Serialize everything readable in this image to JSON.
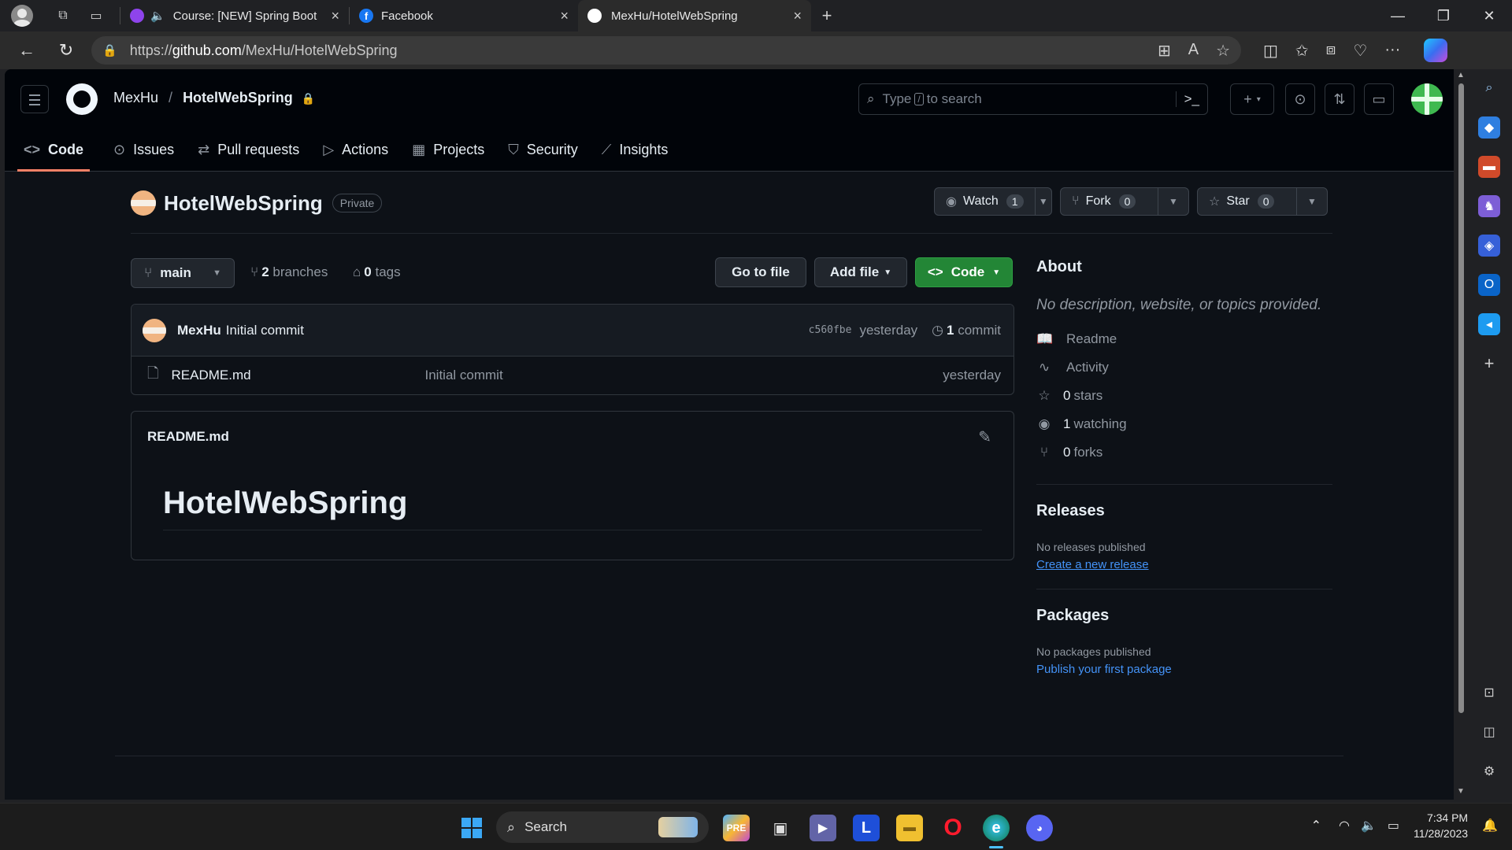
{
  "browser": {
    "tabs": [
      {
        "title": "Course: [NEW] Spring Boot",
        "icon": "udemy-icon"
      },
      {
        "title": "Facebook",
        "icon": "facebook-icon"
      },
      {
        "title": "MexHu/HotelWebSpring",
        "icon": "github-icon",
        "active": true
      }
    ],
    "url_prefix": "https://",
    "url_host": "github.com",
    "url_path": "/MexHu/HotelWebSpring"
  },
  "header": {
    "owner": "MexHu",
    "separator": "/",
    "repo": "HotelWebSpring",
    "search_prefix": "Type",
    "search_key": "/",
    "search_suffix": "to search"
  },
  "repo_nav": [
    {
      "label": "Code",
      "icon": "code-icon",
      "selected": true
    },
    {
      "label": "Issues",
      "icon": "issue-icon"
    },
    {
      "label": "Pull requests",
      "icon": "pull-request-icon"
    },
    {
      "label": "Actions",
      "icon": "play-icon"
    },
    {
      "label": "Projects",
      "icon": "table-icon"
    },
    {
      "label": "Security",
      "icon": "shield-icon"
    },
    {
      "label": "Insights",
      "icon": "graph-icon"
    }
  ],
  "repo": {
    "name": "HotelWebSpring",
    "visibility": "Private",
    "watch": {
      "label": "Watch",
      "count": "1"
    },
    "fork": {
      "label": "Fork",
      "count": "0"
    },
    "star": {
      "label": "Star",
      "count": "0"
    }
  },
  "branch": {
    "current": "main",
    "branches_count": "2",
    "branches_label": "branches",
    "tags_count": "0",
    "tags_label": "tags",
    "go_to_file": "Go to file",
    "add_file": "Add file",
    "code": "Code"
  },
  "commit": {
    "author": "MexHu",
    "message": "Initial commit",
    "sha": "c560fbe",
    "time": "yesterday",
    "count": "1",
    "count_label": "commit"
  },
  "files": [
    {
      "name": "README.md",
      "message": "Initial commit",
      "time": "yesterday",
      "icon": "file-icon"
    }
  ],
  "readme": {
    "title": "README.md",
    "heading": "HotelWebSpring"
  },
  "about": {
    "title": "About",
    "description": "No description, website, or topics provided.",
    "items": [
      {
        "icon": "book-icon",
        "bold": "",
        "label": "Readme"
      },
      {
        "icon": "pulse-icon",
        "bold": "",
        "label": "Activity"
      },
      {
        "icon": "star-icon",
        "bold": "0",
        "label": "stars"
      },
      {
        "icon": "eye-icon",
        "bold": "1",
        "label": "watching"
      },
      {
        "icon": "fork-icon",
        "bold": "0",
        "label": "forks"
      }
    ]
  },
  "releases": {
    "title": "Releases",
    "empty": "No releases published",
    "link": "Create a new release"
  },
  "packages": {
    "title": "Packages",
    "empty": "No packages published",
    "link": "Publish your first package"
  },
  "taskbar": {
    "search": "Search",
    "time": "7:34 PM",
    "date": "11/28/2023"
  },
  "colors": {
    "page_bg": "#0d1117",
    "header_bg": "#010409",
    "accent_green": "#238636",
    "link_blue": "#4493f8",
    "selected_tab_underline": "#f78166"
  }
}
